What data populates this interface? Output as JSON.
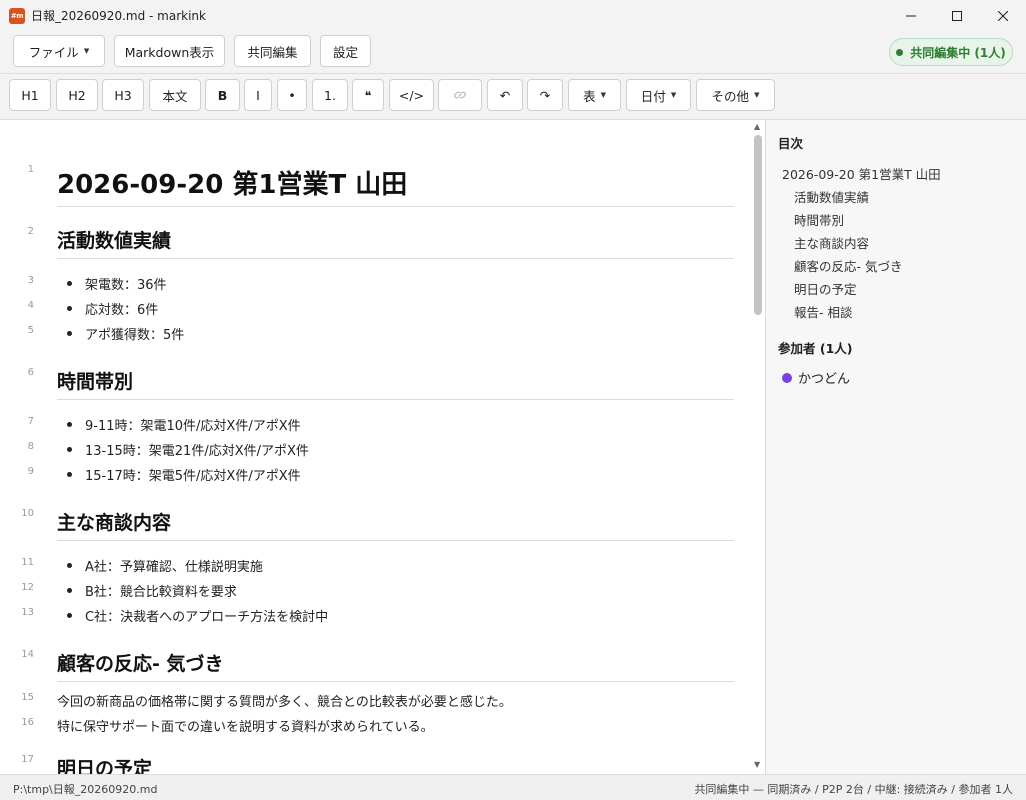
{
  "window": {
    "title": "日報_20260920.md - markink",
    "app_icon": "#m"
  },
  "menu": {
    "file": "ファイル",
    "markdown_view": "Markdown表示",
    "collab_edit": "共同編集",
    "settings": "設定",
    "collab_status": "共同編集中 (1人)",
    "status_color": "#2e7d32"
  },
  "toolbar": {
    "h1": "H1",
    "h2": "H2",
    "h3": "H3",
    "body": "本文",
    "bold": "B",
    "italic": "I",
    "bullet": "•",
    "numbered": "1.",
    "quote": "❝",
    "code": "</>",
    "link_icon": "link-icon",
    "undo": "↶",
    "redo": "↷",
    "table": "表",
    "date": "日付",
    "more": "その他"
  },
  "editor": {
    "line_numbers": [
      "1",
      "2",
      "3",
      "4",
      "5",
      "6",
      "7",
      "8",
      "9",
      "10",
      "11",
      "12",
      "13",
      "14",
      "15",
      "16",
      "17"
    ],
    "title": "2026-09-20 第1営業T 山田",
    "sections": {
      "activity": {
        "heading": "活動数値実績",
        "items": [
          "架電数：36件",
          "応対数：6件",
          "アポ獲得数：5件"
        ]
      },
      "timeslot": {
        "heading": "時間帯別",
        "items": [
          "9-11時：架電10件/応対X件/アポX件",
          "13-15時：架電21件/応対X件/アポX件",
          "15-17時：架電5件/応対X件/アポX件"
        ]
      },
      "deals": {
        "heading": "主な商談内容",
        "items": [
          "A社：予算確認、仕様説明実施",
          "B社：競合比較資料を要求",
          "C社：決裁者へのアプローチ方法を検討中"
        ]
      },
      "feedback": {
        "heading": "顧客の反応- 気づき",
        "paras": [
          "今回の新商品の価格帯に関する質問が多く、競合との比較表が必要と感じた。",
          "特に保守サポート面での違いを説明する資料が求められている。"
        ]
      },
      "tomorrow": {
        "heading": "明日の予定"
      }
    }
  },
  "sidebar": {
    "toc_title": "目次",
    "toc": [
      "2026-09-20 第1営業T 山田",
      "活動数値実績",
      "時間帯別",
      "主な商談内容",
      "顧客の反応- 気づき",
      "明日の予定",
      "報告- 相談"
    ],
    "participants_title": "参加者 (1人)",
    "participants": [
      {
        "name": "かつどん",
        "color": "#7b3fe4"
      }
    ]
  },
  "status": {
    "path": "P:\\tmp\\日報_20260920.md",
    "summary": "共同編集中 — 同期済み / P2P 2台 / 中継: 接続済み / 参加者 1人"
  }
}
